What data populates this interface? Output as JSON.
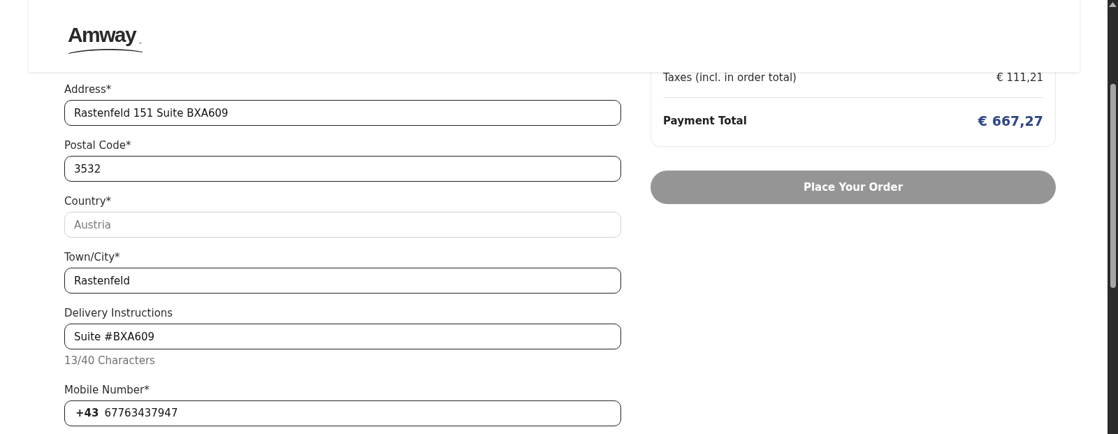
{
  "header": {
    "logo": {
      "wordmark": "Amway",
      "trademark": "™"
    }
  },
  "form": {
    "fields": [
      {
        "kind": "text",
        "label": "Address*",
        "value": "Rastenfeld 151 Suite BXA609",
        "disabled": false
      },
      {
        "kind": "text",
        "label": "Postal Code*",
        "value": "3532",
        "disabled": false
      },
      {
        "kind": "text",
        "label": "Country*",
        "value": "Austria",
        "disabled": true
      },
      {
        "kind": "text",
        "label": "Town/City*",
        "value": "Rastenfeld",
        "disabled": false
      },
      {
        "kind": "text",
        "label": "Delivery Instructions",
        "value": "Suite #BXA609",
        "disabled": false,
        "counter": "13/40 Characters"
      },
      {
        "kind": "phone",
        "label": "Mobile Number*",
        "prefix": "+43",
        "value": "67763437947",
        "disabled": false
      }
    ]
  },
  "summary": {
    "rows": [
      {
        "kind": "line",
        "label": "Taxes (incl. in order total)",
        "value": "€ 111,21"
      },
      {
        "kind": "total",
        "label": "Payment Total",
        "value": "€ 667,27"
      }
    ]
  },
  "place_order_button": {
    "label": "Place Your Order",
    "disabled": true
  }
}
